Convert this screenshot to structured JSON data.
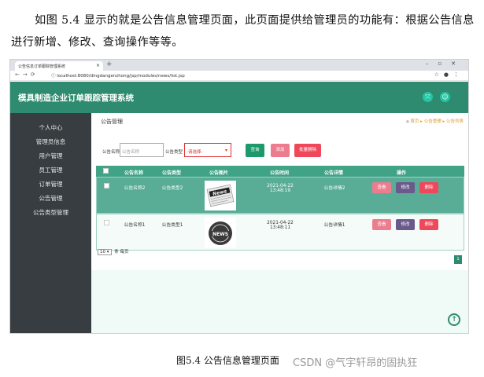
{
  "intro": {
    "text": "如图 5.4 显示的就是公告信息管理页面，此页面提供给管理员的功能有：根据公告信息进行新增、修改、查询操作等等。"
  },
  "browser": {
    "tab_title": "公告信息订单跟踪管理系统",
    "url": "localhost:8080/dingdangenzhong/jsp/modules/news/list.jsp"
  },
  "app": {
    "title": "模具制造企业订单跟踪管理系统"
  },
  "sidebar": {
    "items": [
      {
        "label": "个人中心"
      },
      {
        "label": "管理员信息"
      },
      {
        "label": "用户管理"
      },
      {
        "label": "员工管理"
      },
      {
        "label": "订单管理"
      },
      {
        "label": "公告管理"
      },
      {
        "label": "公告类型管理"
      }
    ]
  },
  "main": {
    "page_title": "公告管理",
    "breadcrumb": {
      "home": "首页",
      "level1": "公告管理",
      "level2": "公告列表"
    }
  },
  "search": {
    "name_label": "公告名称",
    "name_placeholder": "公告名称",
    "type_label": "公告类型",
    "type_selected": "-请选择-",
    "query_button": "查询",
    "add_button": "添加",
    "batch_delete_button": "批量删除"
  },
  "table": {
    "columns": [
      "公告名称",
      "公告类型",
      "公告图片",
      "公告时间",
      "公告详情",
      "操作"
    ],
    "rows": [
      {
        "name": "公告名称2",
        "type": "公告类型2",
        "image": "news-paper-image",
        "time": "2021-04-22 13:48:19",
        "detail": "公告详情2"
      },
      {
        "name": "公告名称1",
        "type": "公告类型1",
        "image": "news-badge-image",
        "time": "2021-04-22 13:48:11",
        "detail": "公告详情1"
      }
    ],
    "actions": {
      "view": "查看",
      "edit": "修改",
      "delete": "删除"
    }
  },
  "pager": {
    "page_size": "10",
    "per_page_text": "条 每页",
    "current_page": "1"
  },
  "caption": "图5.4 公告信息管理页面",
  "watermark": "CSDN @气宇轩昂的固执狂",
  "colors": {
    "header_green": "#2e8b6f",
    "sidebar_dark": "#373d41",
    "query_btn": "#1c9a6b",
    "add_btn": "#ec7d8f",
    "delete_btn": "#f0485b",
    "edit_btn": "#6a5a8c"
  }
}
